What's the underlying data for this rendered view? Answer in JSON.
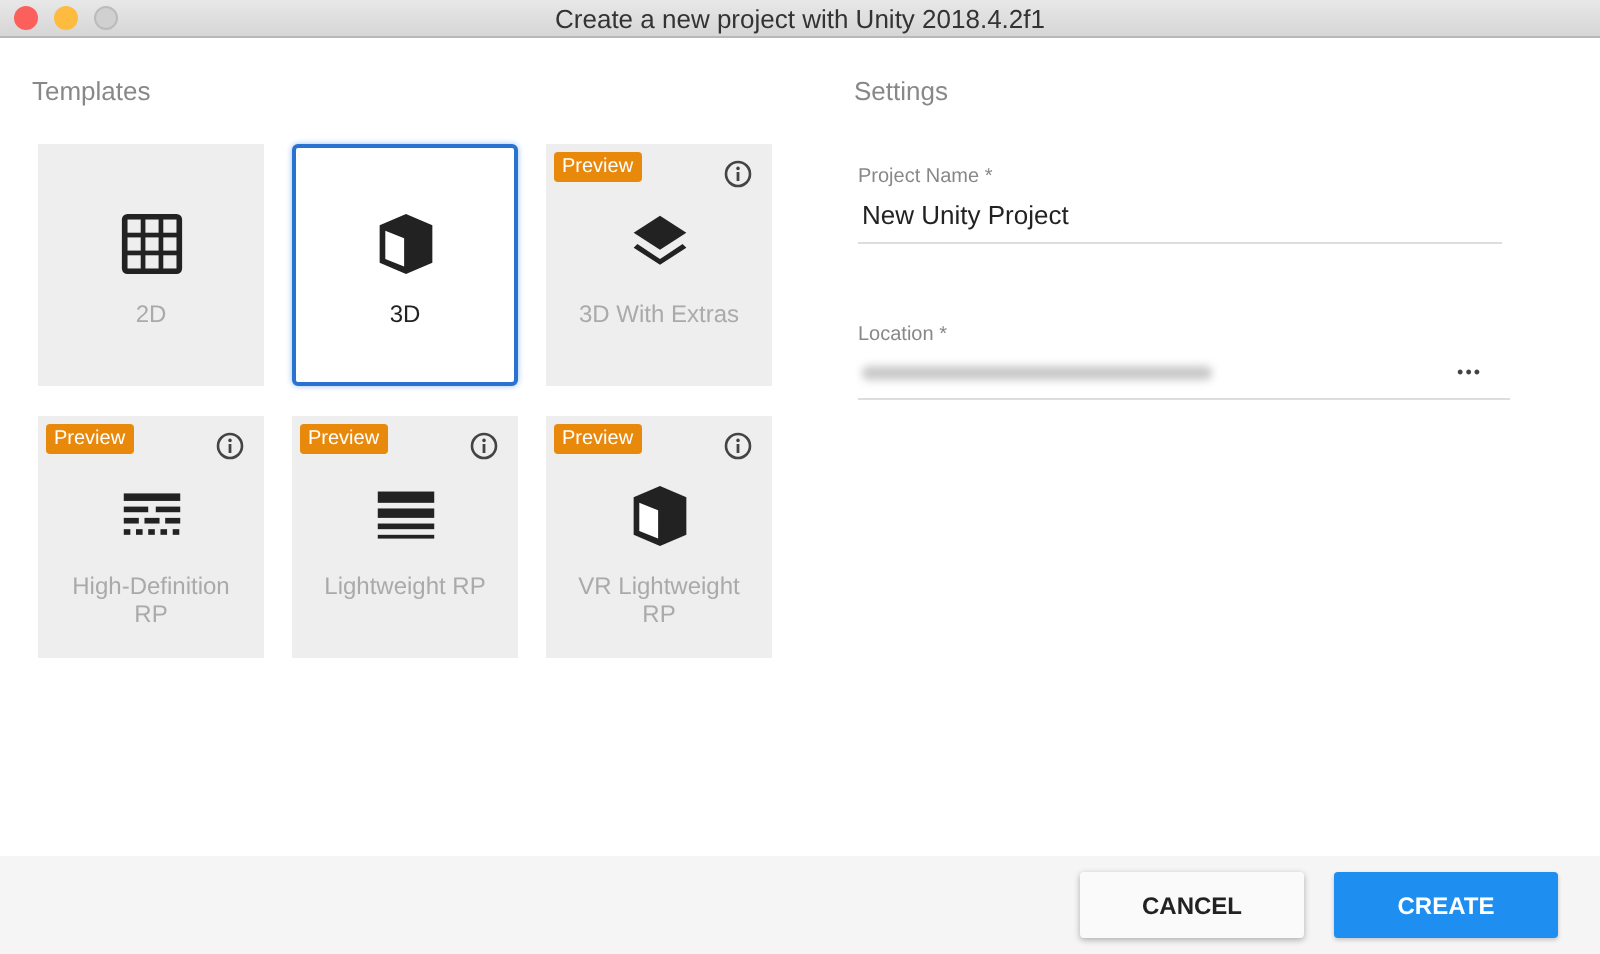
{
  "window": {
    "title": "Create a new project with Unity 2018.4.2f1"
  },
  "templates": {
    "heading": "Templates",
    "items": [
      {
        "label": "2D",
        "kind": "grid",
        "selected": false
      },
      {
        "label": "3D",
        "kind": "cube",
        "selected": true
      },
      {
        "label": "3D With Extras",
        "kind": "layers",
        "selected": false,
        "badge": "Preview"
      },
      {
        "label": "High-Definition RP",
        "kind": "dashes",
        "selected": false,
        "badge": "Preview"
      },
      {
        "label": "Lightweight RP",
        "kind": "bars",
        "selected": false,
        "badge": "Preview"
      },
      {
        "label": "VR Lightweight RP",
        "kind": "cube",
        "selected": false,
        "badge": "Preview"
      }
    ]
  },
  "settings": {
    "heading": "Settings",
    "project_name": {
      "label": "Project Name *",
      "value": "New Unity Project"
    },
    "location": {
      "label": "Location *",
      "browse": "•••"
    }
  },
  "buttons": [
    {
      "label": "CANCEL",
      "kind": "secondary"
    },
    {
      "label": "CREATE",
      "kind": "primary"
    }
  ]
}
